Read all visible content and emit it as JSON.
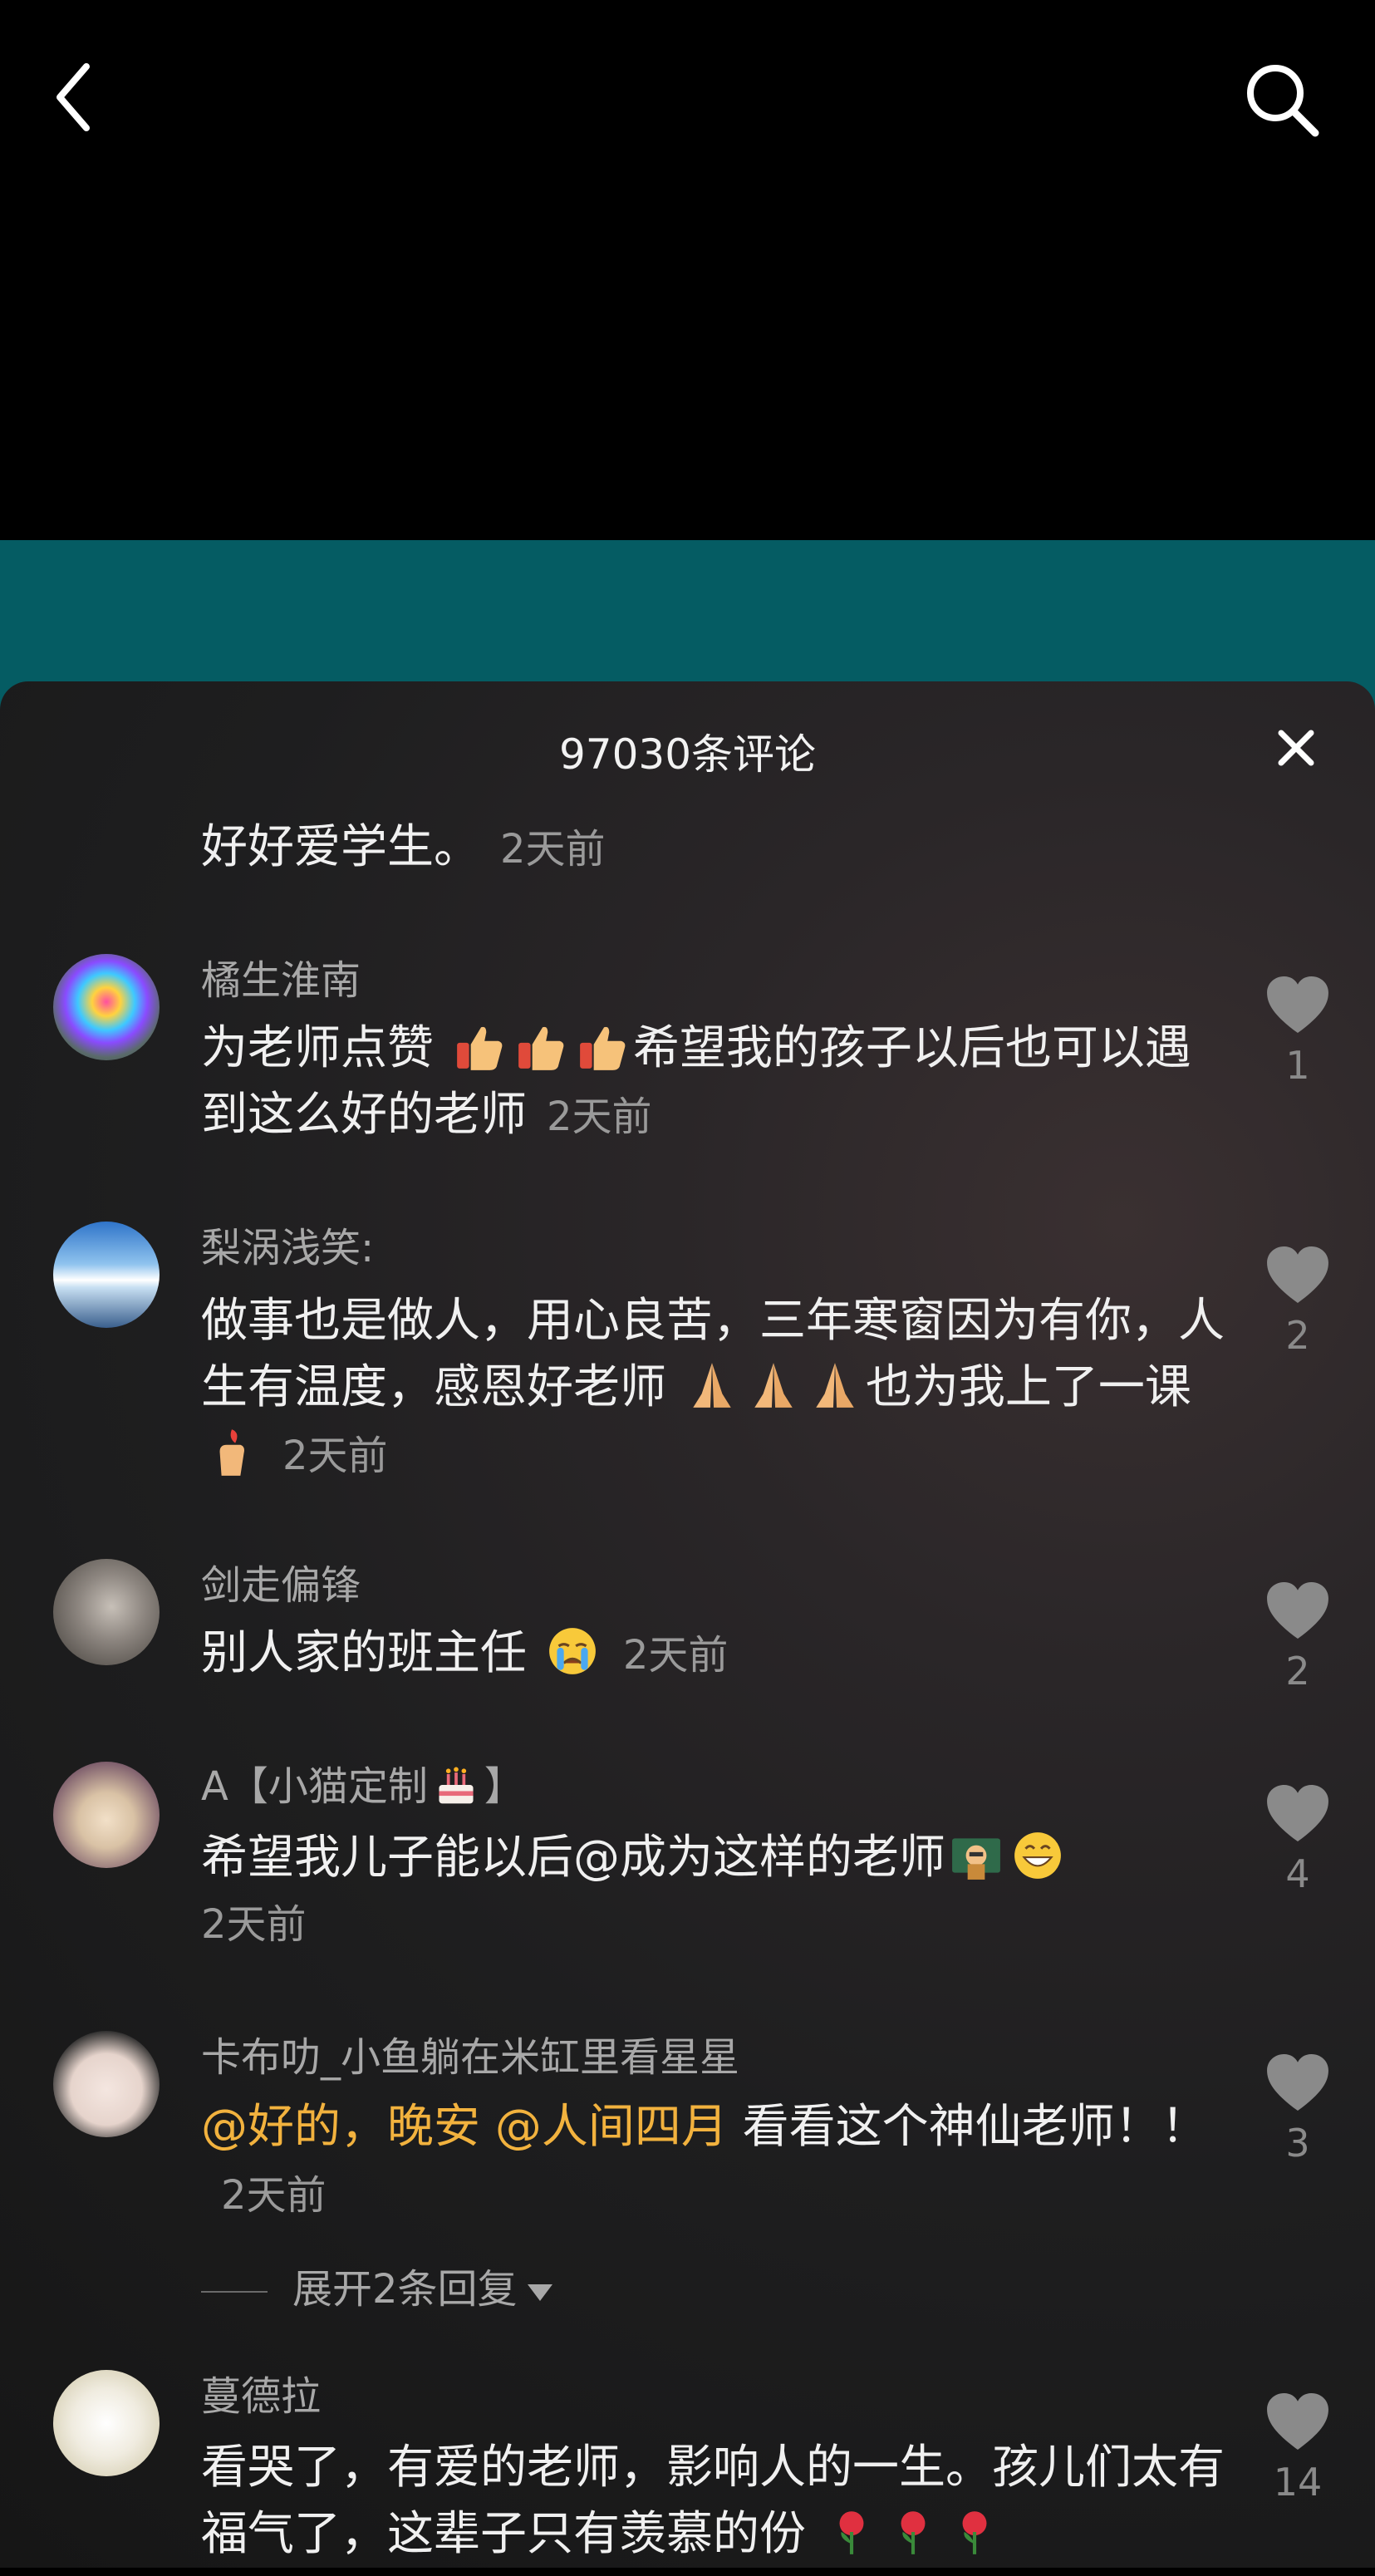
{
  "header": {
    "back_icon": "back-arrow-icon",
    "search_icon": "search-icon"
  },
  "comments_panel": {
    "title": "97030条评论",
    "close_icon": "close-icon",
    "partial_comment": {
      "text": "好好爱学生。",
      "time": "2天前"
    },
    "comments": [
      {
        "name": "橘生淮南",
        "text": "为老师点赞",
        "text2": "希望我的孩子以后也可以遇到这么好的老师",
        "time": "2天前",
        "likes": "1"
      },
      {
        "name": "梨涡浅笑:",
        "text": "做事也是做人，用心良苦，三年寒窗因为有你，人生有温度，感恩好老师",
        "text2": "也为我上了一课",
        "time": "2天前",
        "likes": "2"
      },
      {
        "name": "剑走偏锋",
        "text": "别人家的班主任",
        "time": "2天前",
        "likes": "2"
      },
      {
        "name": "A【小猫定制",
        "name_suffix": "】",
        "text": "希望我儿子能以后@成为这样的老师",
        "time": "2天前",
        "likes": "4"
      },
      {
        "name": "卡布叻_小鱼躺在米缸里看星星",
        "mention1": "@好的，晚安",
        "mention2": "@人间四月",
        "text": " 看看这个神仙老师！！",
        "time": "2天前",
        "likes": "3"
      },
      {
        "name": "蔓德拉",
        "text": "看哭了，有爱的老师，影响人的一生。孩儿们太有福气了，这辈子只有羡慕的份",
        "likes": "14"
      }
    ],
    "expand_replies": "展开2条回复"
  },
  "colors": {
    "teal": "#055c63",
    "mention": "#f2b23e"
  }
}
